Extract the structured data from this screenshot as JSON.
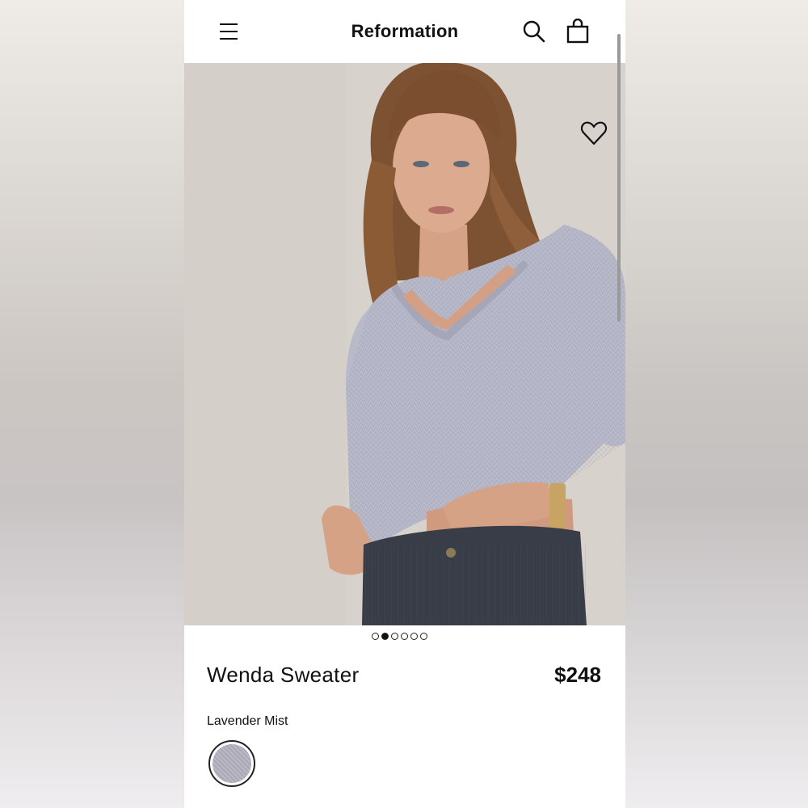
{
  "header": {
    "brand": "Reformation",
    "menu_icon": "menu-icon",
    "search_icon": "search-icon",
    "bag_icon": "bag-icon"
  },
  "gallery": {
    "image_count": 6,
    "active_index": 1,
    "wishlist_icon": "heart-icon"
  },
  "product": {
    "name": "Wenda Sweater",
    "price": "$248",
    "color_name": "Lavender Mist"
  },
  "colors": {
    "swatch": "#b3b1bf",
    "sweater": "#b7b8c8",
    "pants": "#3a3f4a",
    "hair": "#8a5a35",
    "skin": "#d9a88c"
  }
}
